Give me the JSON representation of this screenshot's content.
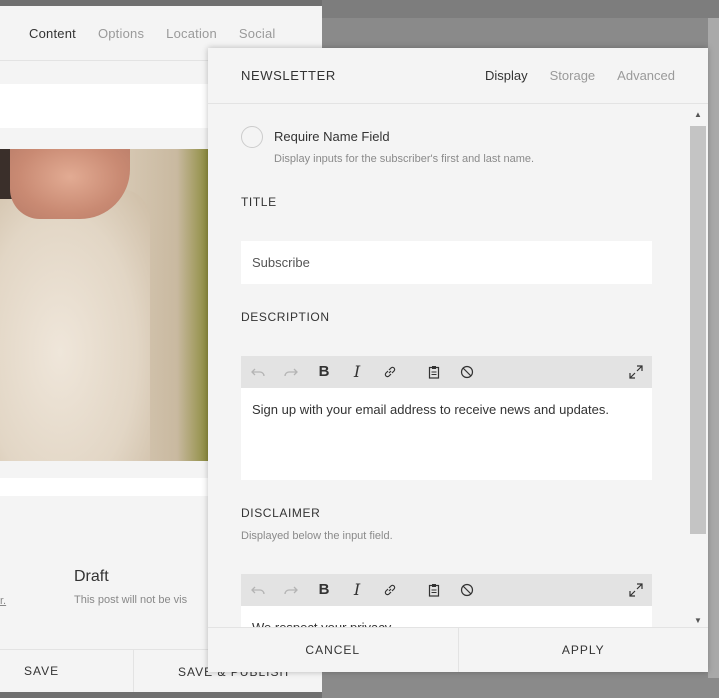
{
  "post_editor": {
    "tabs": [
      {
        "label": "Content",
        "active": true
      },
      {
        "label": "Options",
        "active": false
      },
      {
        "label": "Location",
        "active": false
      },
      {
        "label": "Social",
        "active": false
      }
    ],
    "status_title": "Draft",
    "status_desc": "This post will not be vis",
    "link_fragment": "r.",
    "save_label": "SAVE",
    "save_publish_label": "SAVE & PUBLISH"
  },
  "newsletter": {
    "title": "NEWSLETTER",
    "tabs": [
      {
        "label": "Display",
        "active": true
      },
      {
        "label": "Storage",
        "active": false
      },
      {
        "label": "Advanced",
        "active": false
      }
    ],
    "require_name": {
      "label": "Require Name Field",
      "description": "Display inputs for the subscriber's first and last name.",
      "checked": false
    },
    "title_section": {
      "label": "TITLE",
      "value": "Subscribe"
    },
    "description_section": {
      "label": "DESCRIPTION",
      "content": "Sign up with your email address to receive news and updates."
    },
    "disclaimer_section": {
      "label": "DISCLAIMER",
      "sublabel": "Displayed below the input field.",
      "content": "We respect your privacy."
    },
    "toolbar_icons": [
      "undo-icon",
      "redo-icon",
      "bold-icon",
      "italic-icon",
      "link-icon",
      "clipboard-icon",
      "clear-format-icon",
      "expand-icon"
    ],
    "cancel_label": "CANCEL",
    "apply_label": "APPLY"
  }
}
